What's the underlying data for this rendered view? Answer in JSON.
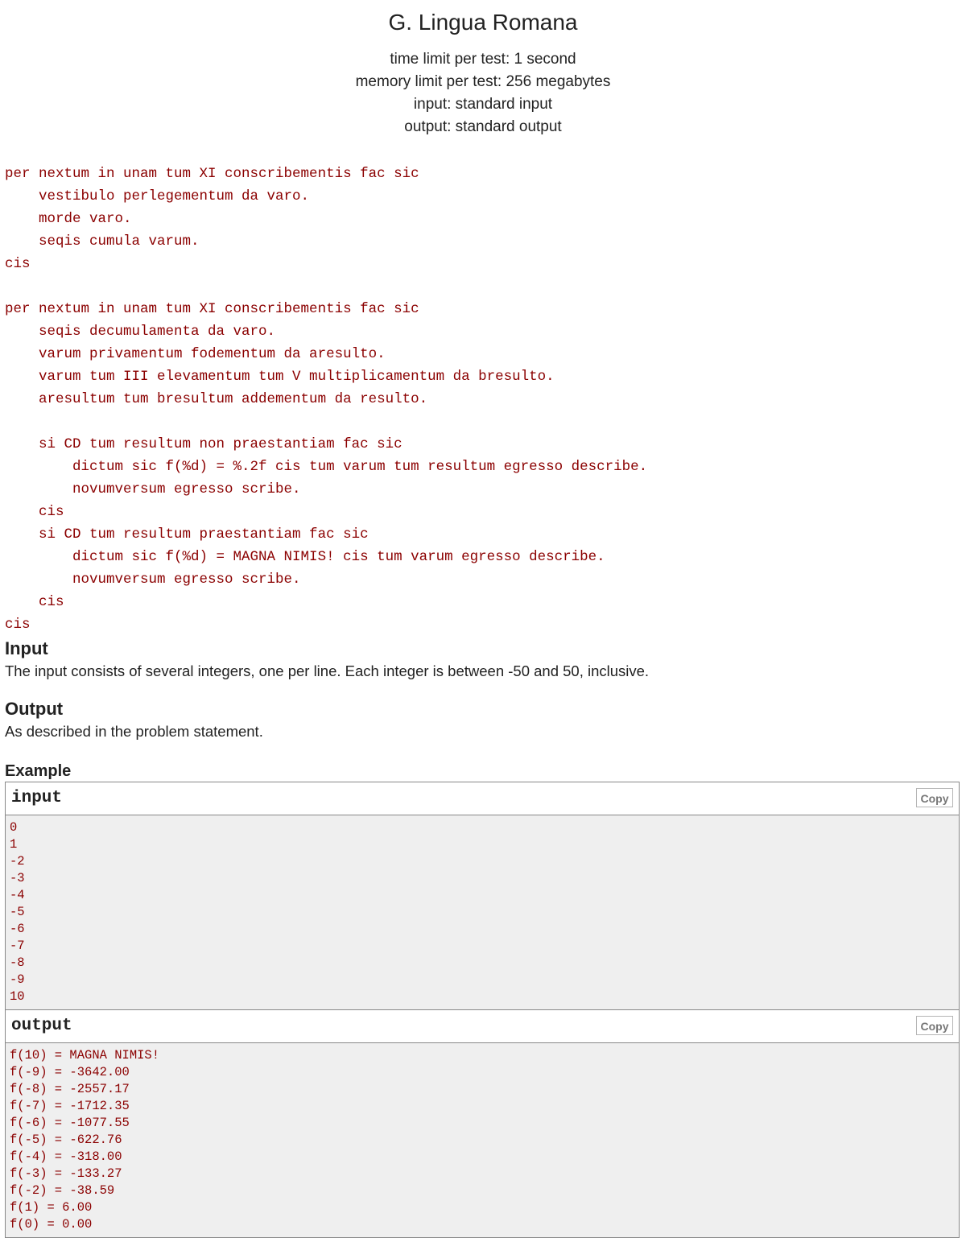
{
  "problem": {
    "title": "G. Lingua Romana",
    "time_limit": "time limit per test: 1 second",
    "memory_limit": "memory limit per test: 256 megabytes",
    "input_file": "input: standard input",
    "output_file": "output: standard output"
  },
  "statement_lines": [
    "per nextum in unam tum XI conscribementis fac sic",
    "    vestibulo perlegementum da varo.",
    "    morde varo.",
    "    seqis cumula varum.",
    "cis",
    "",
    "per nextum in unam tum XI conscribementis fac sic",
    "    seqis decumulamenta da varo.",
    "    varum privamentum fodementum da aresulto.",
    "    varum tum III elevamentum tum V multiplicamentum da bresulto.",
    "    aresultum tum bresultum addementum da resulto.",
    "",
    "    si CD tum resultum non praestantiam fac sic",
    "        dictum sic f(%d) = %.2f cis tum varum tum resultum egresso describe.",
    "        novumversum egresso scribe.",
    "    cis",
    "    si CD tum resultum praestantiam fac sic",
    "        dictum sic f(%d) = MAGNA NIMIS! cis tum varum egresso describe.",
    "        novumversum egresso scribe.",
    "    cis",
    "cis"
  ],
  "input_section": {
    "title": "Input",
    "text": "The input consists of several integers, one per line. Each integer is between -50 and 50, inclusive."
  },
  "output_section": {
    "title": "Output",
    "text": "As described in the problem statement."
  },
  "example": {
    "title": "Example",
    "copy_label": "Copy",
    "input_label": "input",
    "input_lines": [
      "0",
      "1",
      "-2",
      "-3",
      "-4",
      "-5",
      "-6",
      "-7",
      "-8",
      "-9",
      "10"
    ],
    "output_label": "output",
    "output_lines": [
      "f(10) = MAGNA NIMIS!",
      "f(-9) = -3642.00",
      "f(-8) = -2557.17",
      "f(-7) = -1712.35",
      "f(-6) = -1077.55",
      "f(-5) = -622.76",
      "f(-4) = -318.00",
      "f(-3) = -133.27",
      "f(-2) = -38.59",
      "f(1) = 6.00",
      "f(0) = 0.00"
    ]
  }
}
